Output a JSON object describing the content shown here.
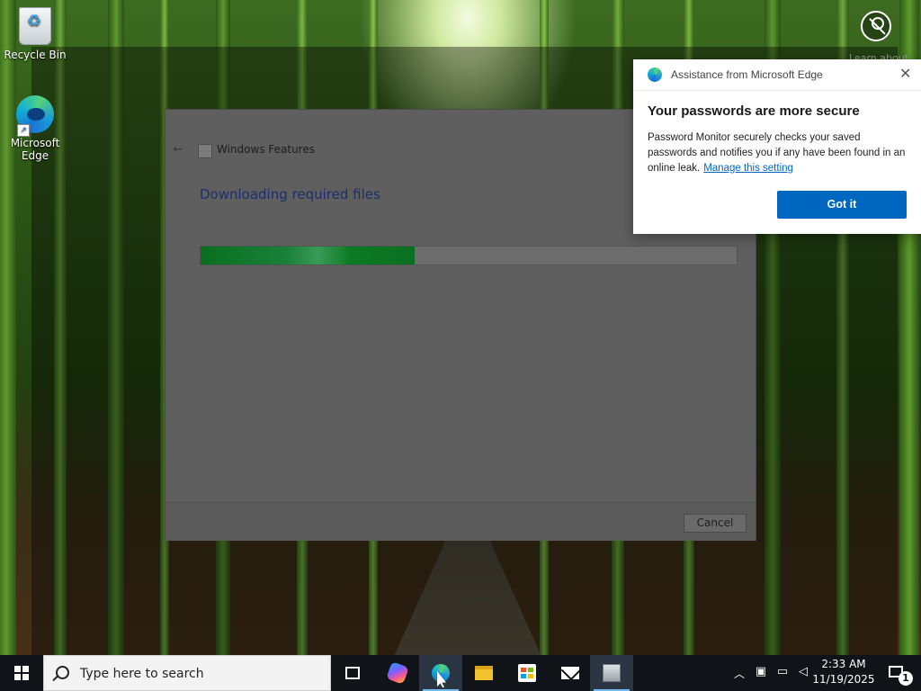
{
  "desktop": {
    "icons": [
      {
        "label": "Recycle Bin",
        "icon": "recycle-bin-icon"
      },
      {
        "label": "Microsoft Edge",
        "icon": "edge-icon"
      }
    ],
    "watermark_text": "Learn about"
  },
  "dialog": {
    "title": "Windows Features",
    "back_icon": "back-arrow-icon",
    "heading": "Downloading required files",
    "progress_fraction": 0.4,
    "cancel_label": "Cancel"
  },
  "toast": {
    "app_name": "Assistance from Microsoft Edge",
    "title": "Your passwords are more secure",
    "body": "Password Monitor securely checks your saved passwords and notifies you if any have been found in an online leak.",
    "link_text": "Manage this setting",
    "button_label": "Got it",
    "accent_color": "#0067c0"
  },
  "taskbar": {
    "search_placeholder": "Type here to search",
    "items": [
      {
        "name": "task-view",
        "icon": "task-view-icon"
      },
      {
        "name": "copilot",
        "icon": "copilot-icon"
      },
      {
        "name": "edge",
        "icon": "edge-icon",
        "active": true
      },
      {
        "name": "file-explorer",
        "icon": "folder-icon"
      },
      {
        "name": "microsoft-store",
        "icon": "store-icon"
      },
      {
        "name": "mail",
        "icon": "mail-icon"
      },
      {
        "name": "windows-features",
        "icon": "windows-features-icon"
      }
    ],
    "clock_time": "2:33 AM",
    "clock_date": "11/19/2025",
    "notification_count": "1"
  }
}
